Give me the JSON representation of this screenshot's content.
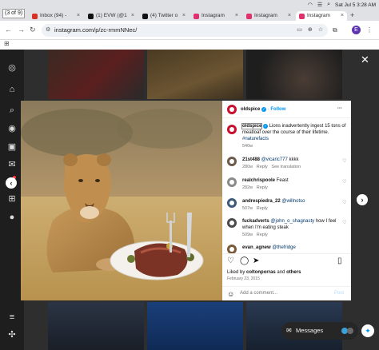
{
  "browser": {
    "page_counter": "(3 of 9)",
    "tabs": [
      {
        "label": "Inbox (94) - ",
        "icon": "gmail-icon",
        "color": "#d93025"
      },
      {
        "label": "(1) EVW (@1",
        "icon": "x-icon",
        "color": "#111111"
      },
      {
        "label": "(4) Twitter o",
        "icon": "x-icon",
        "color": "#111111"
      },
      {
        "label": "Instagram",
        "icon": "instagram-icon",
        "color": "#e1306c"
      },
      {
        "label": "Instagram",
        "icon": "instagram-icon",
        "color": "#e1306c"
      },
      {
        "label": "Instagram",
        "icon": "instagram-icon",
        "color": "#e1306c"
      }
    ],
    "clock": "Sat Jul 5  3:28 AM",
    "url": "instagram.com/p/zc-rmmNNec/",
    "profile_initial": "E"
  },
  "post": {
    "username": "oldspice",
    "follow_label": "Follow",
    "more_label": "···",
    "caption_user": "oldspice",
    "caption_text": "Lions inadvertently ingest 15 tons of meatloaf over the course of their lifetime.",
    "hashtag": "#naturefacts",
    "caption_age": "540w",
    "comments": [
      {
        "user": "21st488",
        "mention": "@vicaric777",
        "text": "kkkk",
        "age": "280w",
        "reply": "Reply",
        "extra": "See translation"
      },
      {
        "user": "realchrispoole",
        "mention": "",
        "text": "Feast",
        "age": "282w",
        "reply": "Reply",
        "extra": ""
      },
      {
        "user": "andrespiedra_22",
        "mention": "@willnotso",
        "text": "",
        "age": "507w",
        "reply": "Reply",
        "extra": ""
      },
      {
        "user": "fuckadverts",
        "mention": "@john_o_shagnasty",
        "text": "how I feel when I'm eating steak",
        "age": "509w",
        "reply": "Reply",
        "extra": ""
      },
      {
        "user": "evan_agnew",
        "mention": "@thefridge",
        "text": "",
        "age": "",
        "reply": "",
        "extra": ""
      }
    ],
    "liked_prefix": "Liked by",
    "liked_user": "coltonporras",
    "liked_and": "and",
    "liked_others": "others",
    "date": "February 23, 2015",
    "comment_placeholder": "Add a comment...",
    "post_label": "Post"
  },
  "messages_label": "Messages",
  "colors": {
    "link": "#00376b",
    "follow": "#0095f6",
    "brand": "#c8102e"
  }
}
